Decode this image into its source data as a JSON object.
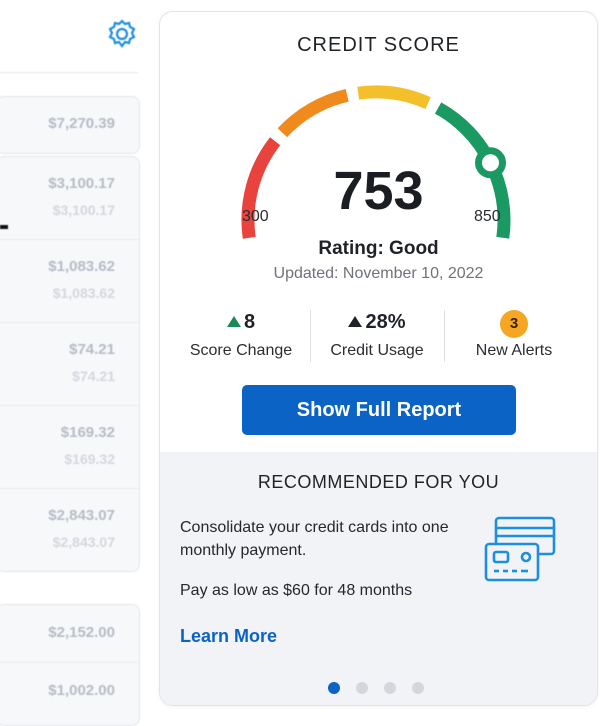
{
  "background_list": {
    "groups": [
      {
        "rows": [
          {
            "amount": "$7,270.39"
          }
        ]
      },
      {
        "rows": [
          {
            "amount": "$3,100.17",
            "sub": "$3,100.17"
          },
          {
            "amount": "$1,083.62",
            "sub": "$1,083.62"
          },
          {
            "amount": "$74.21",
            "sub": "$74.21"
          },
          {
            "amount": "$169.32",
            "sub": "$169.32"
          },
          {
            "amount": "$2,843.07",
            "sub": "$2,843.07"
          }
        ]
      },
      {
        "rows": [
          {
            "amount": "$2,152.00"
          },
          {
            "amount": "$1,002.00"
          }
        ]
      }
    ]
  },
  "credit_card": {
    "title": "CREDIT SCORE",
    "score": "753",
    "score_value": 753,
    "min": "300",
    "max": "850",
    "min_value": 300,
    "max_value": 850,
    "rating": "Rating: Good",
    "updated": "Updated: November 10, 2022",
    "stats": {
      "score_change": {
        "value": "8",
        "label": "Score Change"
      },
      "credit_usage": {
        "value": "28%",
        "label": "Credit Usage"
      },
      "new_alerts": {
        "value": "3",
        "label": "New Alerts"
      }
    },
    "button_label": "Show Full Report",
    "colors": {
      "red": "#e8433c",
      "orange": "#f08a1c",
      "yellow": "#f3c02b",
      "green": "#1a9a62",
      "blue": "#0b63c5",
      "badge": "#f5a623"
    }
  },
  "recommended": {
    "title": "RECOMMENDED FOR YOU",
    "description": "Consolidate your credit cards into one monthly payment.",
    "offer": "Pay as low as $60 for 48 months",
    "link_label": "Learn More",
    "icon": "credit-cards-icon"
  },
  "carousel": {
    "count": 4,
    "active": 1
  },
  "icons": {
    "settings": "gear-icon"
  }
}
